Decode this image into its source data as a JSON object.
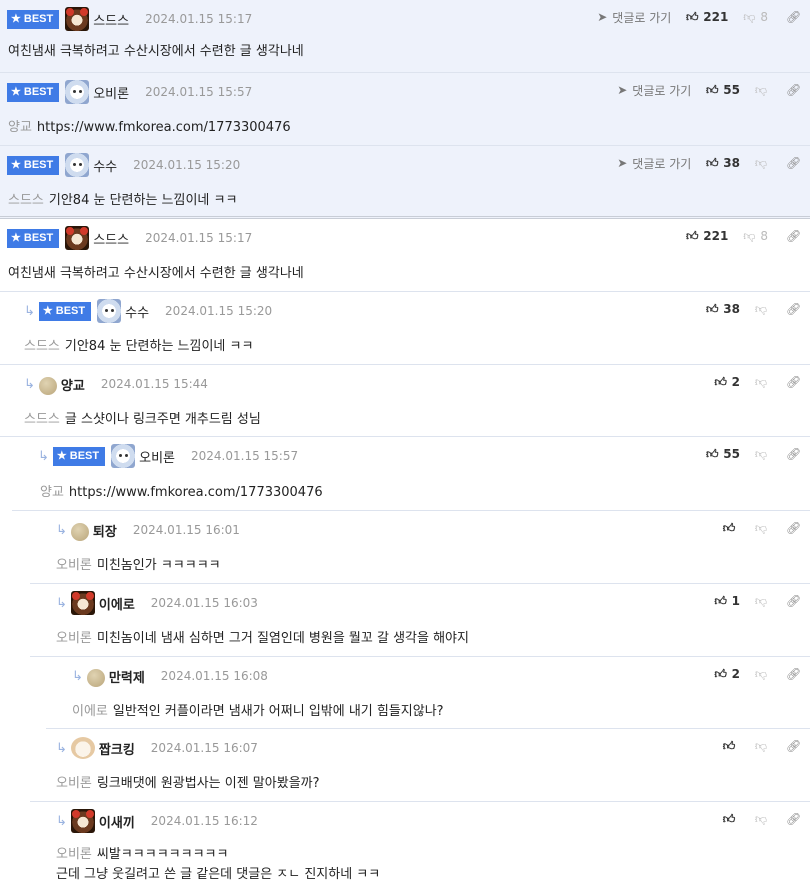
{
  "labels": {
    "best": "BEST",
    "goto_comment": "댓글로 가기"
  },
  "best_comments": [
    {
      "nick": "스드스",
      "date": "2024.01.15 15:17",
      "up": "221",
      "down": "8",
      "to": "",
      "text": "여친냄새 극복하려고 수산시장에서 수련한 글 생각나네",
      "avatar": "bear"
    },
    {
      "nick": "오비론",
      "date": "2024.01.15 15:57",
      "up": "55",
      "down": "",
      "to": "양교",
      "text": "https://www.fmkorea.com/1773300476",
      "avatar": "dog"
    },
    {
      "nick": "수수",
      "date": "2024.01.15 15:20",
      "up": "38",
      "down": "",
      "to": "스드스",
      "text": "기안84 눈 단련하는 느낌이네 ㅋㅋ",
      "avatar": "dog"
    }
  ],
  "comments": [
    {
      "nick": "스드스",
      "date": "2024.01.15 15:17",
      "up": "221",
      "down": "8",
      "to": "",
      "text": "여친냄새 극복하려고 수산시장에서 수련한 글 생각나네"
    },
    {
      "nick": "수수",
      "date": "2024.01.15 15:20",
      "up": "38",
      "down": "",
      "to": "스드스",
      "text": "기안84 눈 단련하는 느낌이네 ㅋㅋ"
    },
    {
      "nick": "양교",
      "date": "2024.01.15 15:44",
      "up": "2",
      "down": "",
      "to": "스드스",
      "text": "글 스샷이나 링크주면 개추드림 성님"
    },
    {
      "nick": "오비론",
      "date": "2024.01.15 15:57",
      "up": "55",
      "down": "",
      "to": "양교",
      "text": "https://www.fmkorea.com/1773300476"
    },
    {
      "nick": "퇴장",
      "date": "2024.01.15 16:01",
      "up": "",
      "down": "",
      "to": "오비론",
      "text": "미친놈인가 ㅋㅋㅋㅋㅋ"
    },
    {
      "nick": "이에로",
      "date": "2024.01.15 16:03",
      "up": "1",
      "down": "",
      "to": "오비론",
      "text": "미친놈이네 냄새 심하면 그거 질염인데 병원을 뭘꼬 갈 생각을 해야지"
    },
    {
      "nick": "만력제",
      "date": "2024.01.15 16:08",
      "up": "2",
      "down": "",
      "to": "이에로",
      "text": "일반적인 커플이라면 냄새가 어쩌니 입밖에 내기 힘들지않나?"
    },
    {
      "nick": "짭크킹",
      "date": "2024.01.15 16:07",
      "up": "",
      "down": "",
      "to": "오비론",
      "text": "링크배댓에 원광법사는 이젠 말아봤을까?"
    },
    {
      "nick": "이새끼",
      "date": "2024.01.15 16:12",
      "up": "",
      "down": "",
      "to": "오비론",
      "text": "씨발ㅋㅋㅋㅋㅋㅋㅋㅋㅋ",
      "text2": "근데 그냥 웃길려고 쓴 글 같은데 댓글은 ㅈㄴ 진지하네 ㅋㅋ"
    }
  ]
}
